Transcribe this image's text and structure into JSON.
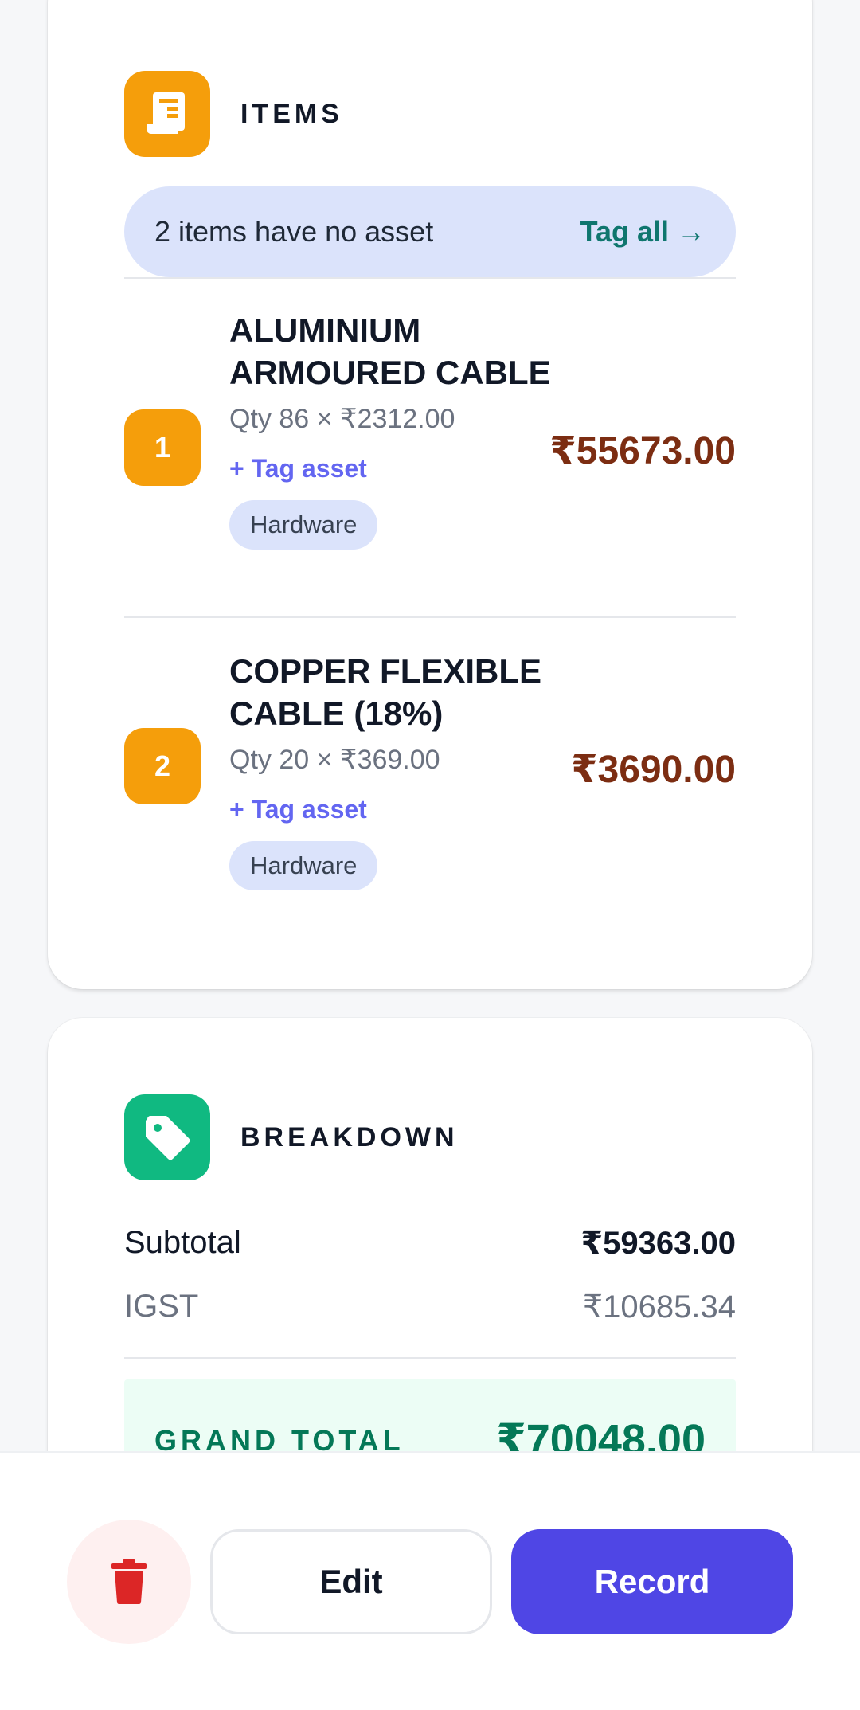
{
  "items_section": {
    "icon": "receipt-icon",
    "title": "ITEMS",
    "notice_text": "2 items have no asset",
    "tag_all_label": "Tag all →",
    "items": [
      {
        "index": "1",
        "name": "ALUMINIUM ARMOURED CABLE",
        "qty": "Qty 86 × ₹2312.00",
        "tag_asset": "+ Tag asset",
        "category": "Hardware",
        "amount": "₹55673.00"
      },
      {
        "index": "2",
        "name": "COPPER FLEXIBLE CABLE (18%)",
        "qty": "Qty 20 × ₹369.00",
        "tag_asset": "+ Tag asset",
        "category": "Hardware",
        "amount": "₹3690.00"
      }
    ]
  },
  "breakdown_section": {
    "icon": "tag-icon",
    "title": "BREAKDOWN",
    "subtotal_label": "Subtotal",
    "subtotal_value": "₹59363.00",
    "igst_label": "IGST",
    "igst_value": "₹10685.34",
    "grand_total_label": "GRAND TOTAL",
    "grand_total_value": "₹70048.00"
  },
  "actions": {
    "delete_icon": "trash-icon",
    "edit_label": "Edit",
    "record_label": "Record"
  },
  "colors": {
    "accent": "#4f46e5",
    "items_icon_bg": "#f59e0b",
    "breakdown_icon_bg": "#10b981",
    "amount_text": "#7c2d12",
    "grand_total_text": "#047857",
    "delete_icon": "#dc2626"
  }
}
